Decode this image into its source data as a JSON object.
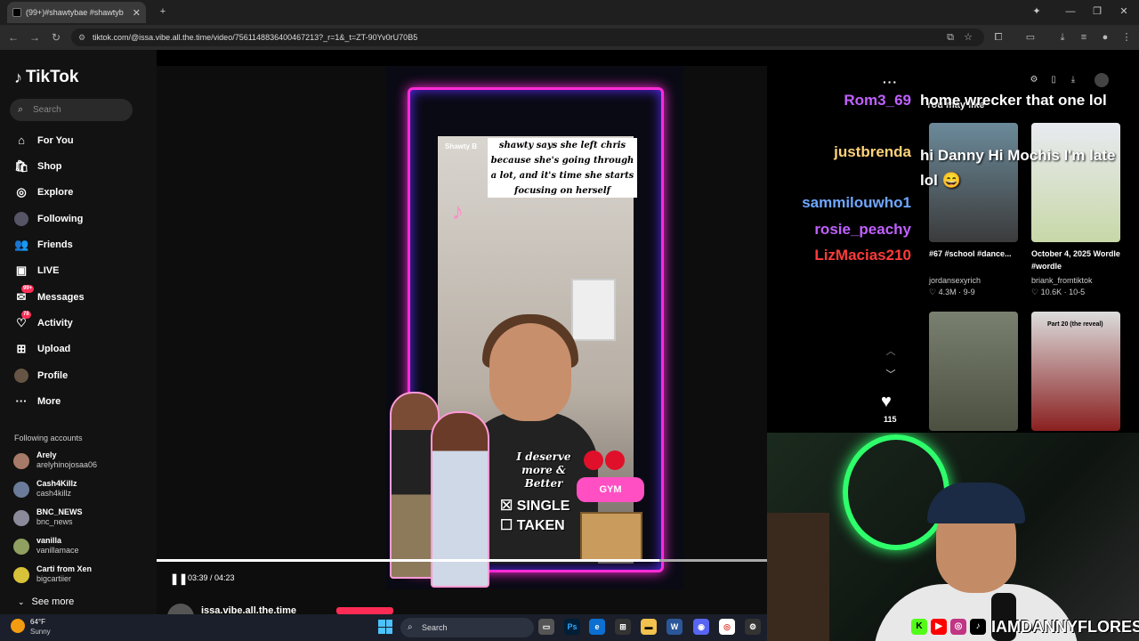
{
  "browser": {
    "tab_title": "(99+)#shawtybae #shawtyb",
    "tab_close": "✕",
    "new_tab": "+",
    "url": "tiktok.com/@issa.vibe.all.the.time/video/7561148836400467213?_r=1&_t=ZT-90Yv0rU70B5",
    "window_controls": [
      "—",
      "❐",
      "✕"
    ]
  },
  "tiktok": {
    "logo": "TikTok",
    "search_placeholder": "Search",
    "nav": [
      {
        "label": "For You",
        "icon": "home-icon"
      },
      {
        "label": "Shop",
        "icon": "shop-icon"
      },
      {
        "label": "Explore",
        "icon": "compass-icon"
      },
      {
        "label": "Following",
        "icon": "following-avatar-icon"
      },
      {
        "label": "Friends",
        "icon": "friends-icon"
      },
      {
        "label": "LIVE",
        "icon": "live-icon"
      },
      {
        "label": "Messages",
        "icon": "messages-icon",
        "badge": "99+"
      },
      {
        "label": "Activity",
        "icon": "activity-icon",
        "badge": "78"
      },
      {
        "label": "Upload",
        "icon": "upload-icon"
      },
      {
        "label": "Profile",
        "icon": "profile-icon"
      },
      {
        "label": "More",
        "icon": "more-icon"
      }
    ],
    "following_header": "Following accounts",
    "accounts": [
      {
        "name": "Arely",
        "handle": "arelyhinojosaa06"
      },
      {
        "name": "Cash4Killz",
        "handle": "cash4killz"
      },
      {
        "name": "BNC_NEWS",
        "handle": "bnc_news"
      },
      {
        "name": "vanilla",
        "handle": "vanillamace"
      },
      {
        "name": "Carti from Xen",
        "handle": "bigcartiier"
      }
    ],
    "see_more": "See more"
  },
  "video": {
    "caption": "shawty says she left chris because she's going through a lot, and it's time she starts focusing on herself",
    "handle_overlay": "Shawty B",
    "sticker_text": "I deserve more & Better",
    "single": "SINGLE",
    "taken": "TAKEN",
    "gym": "GYM",
    "time": "03:39 / 04:23",
    "progress": 0.824,
    "uploader": "issa.vibe.all.the.time",
    "likes": "115"
  },
  "chat": [
    {
      "user": "Rom3_69",
      "color": "#c061ff",
      "message": "home wrecker that one lol"
    },
    {
      "user": "justbrenda",
      "color": "#ffd27a",
      "message": "hi Danny Hi Mochis I'm late lol 😄"
    },
    {
      "user": "sammilouwho1",
      "color": "#6fa8ff",
      "message": ""
    },
    {
      "user": "rosie_peachy",
      "color": "#c061ff",
      "message": ""
    },
    {
      "user": "LizMacias210",
      "color": "#ff3b3b",
      "message": ""
    }
  ],
  "recommendations": {
    "header": "You may like",
    "cards": [
      {
        "title": "#67 #school #dance...",
        "user": "jordansexyrich",
        "stats": "4.3M · 9-9"
      },
      {
        "title": "October 4, 2025 Wordle #wordle",
        "user": "briank_fromtiktok",
        "stats": "10.6K · 10-5"
      },
      {
        "title": "",
        "user": "",
        "stats": ""
      },
      {
        "title": "Part 20 (the reveal)",
        "user": "",
        "stats": ""
      }
    ]
  },
  "stream": {
    "handle": "IAMDANNYFLORES"
  },
  "taskbar": {
    "temp": "64°F",
    "weather": "Sunny",
    "search": "Search"
  }
}
